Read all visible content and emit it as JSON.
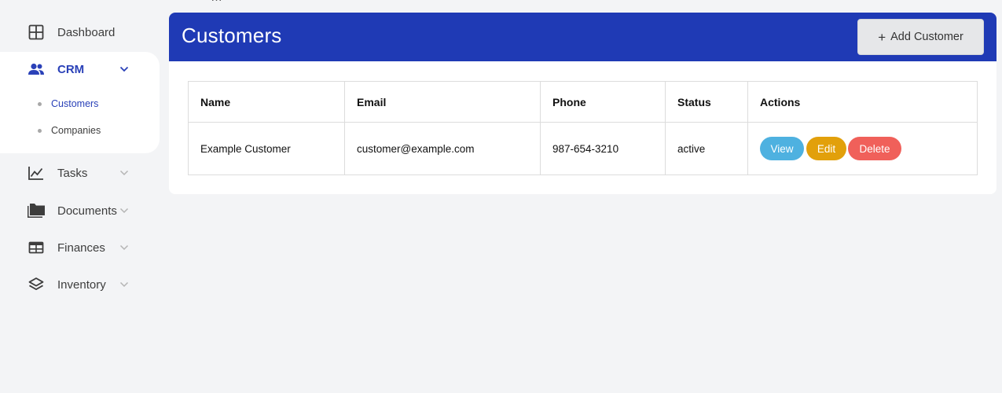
{
  "top_text": "…",
  "sidebar": {
    "items": [
      {
        "label": "Dashboard",
        "icon": "grid-icon"
      },
      {
        "label": "CRM",
        "icon": "users-icon",
        "expanded": true,
        "children": [
          {
            "label": "Customers",
            "active": true
          },
          {
            "label": "Companies",
            "active": false
          }
        ]
      },
      {
        "label": "Tasks",
        "icon": "chart-line-icon"
      },
      {
        "label": "Documents",
        "icon": "folder-icon"
      },
      {
        "label": "Finances",
        "icon": "table-icon"
      },
      {
        "label": "Inventory",
        "icon": "layers-icon"
      }
    ]
  },
  "header": {
    "title": "Customers",
    "add_button_label": "Add Customer",
    "add_button_icon": "plus-icon"
  },
  "table": {
    "columns": [
      "Name",
      "Email",
      "Phone",
      "Status",
      "Actions"
    ],
    "rows": [
      {
        "name": "Example Customer",
        "email": "customer@example.com",
        "phone": "987-654-3210",
        "status": "active",
        "actions": [
          "View",
          "Edit",
          "Delete"
        ]
      }
    ]
  },
  "colors": {
    "header_bg": "#1f3ab5",
    "accent_text": "#2a41b8",
    "view": "#4eb1e0",
    "edit": "#e2a00b",
    "delete": "#f0605a"
  }
}
